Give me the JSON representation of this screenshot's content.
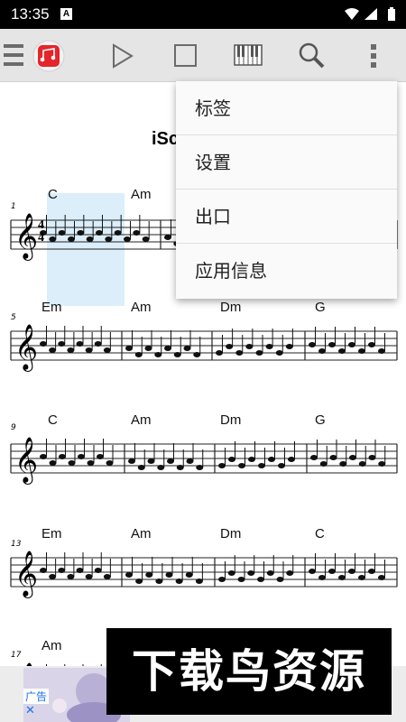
{
  "status_bar": {
    "time": "13:35",
    "notification_badge": "A"
  },
  "toolbar": {
    "icons": [
      "menu-icon",
      "app-logo-icon",
      "play-icon",
      "stop-icon",
      "piano-icon",
      "search-icon",
      "more-vert-icon"
    ],
    "accent": "#e5252a"
  },
  "score": {
    "title_partial": "iSc",
    "rows": [
      {
        "bar_start": "1",
        "chords": [
          "C",
          "Am"
        ]
      },
      {
        "bar_start": "5",
        "chords": [
          "Em",
          "Am",
          "Dm",
          "G"
        ]
      },
      {
        "bar_start": "9",
        "chords": [
          "C",
          "Am",
          "Dm",
          "G"
        ]
      },
      {
        "bar_start": "13",
        "chords": [
          "Em",
          "Am",
          "Dm",
          "C"
        ]
      },
      {
        "bar_start": "17",
        "chords": [
          "Am"
        ]
      }
    ],
    "time_signature": {
      "top": "4",
      "bottom": "4"
    },
    "highlight_color": "#dbeefa"
  },
  "menu": {
    "items": [
      "标签",
      "设置",
      "出口",
      "应用信息"
    ]
  },
  "ad": {
    "label": "广告",
    "close": "✕"
  },
  "watermark": {
    "text": "下载鸟资源"
  }
}
